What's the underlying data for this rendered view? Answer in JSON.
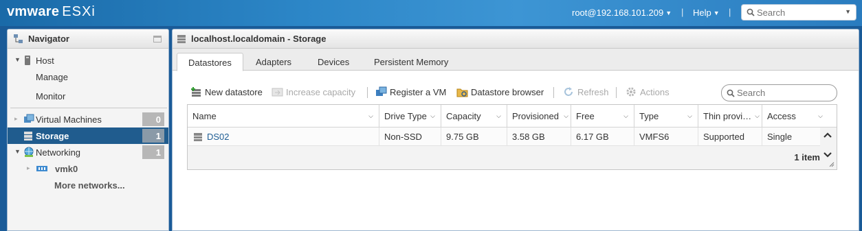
{
  "header": {
    "brand_vm": "vmware",
    "brand_product": "ESXi",
    "user": "root@192.168.101.209",
    "help": "Help",
    "search_placeholder": "Search"
  },
  "navigator": {
    "title": "Navigator",
    "host": "Host",
    "manage": "Manage",
    "monitor": "Monitor",
    "vms": {
      "label": "Virtual Machines",
      "count": "0"
    },
    "storage": {
      "label": "Storage",
      "count": "1"
    },
    "networking": {
      "label": "Networking",
      "count": "1"
    },
    "vmk0": "vmk0",
    "more_networks": "More networks..."
  },
  "main": {
    "title": "localhost.localdomain - Storage",
    "tabs": [
      "Datastores",
      "Adapters",
      "Devices",
      "Persistent Memory"
    ],
    "toolbar": {
      "new_datastore": "New datastore",
      "increase_capacity": "Increase capacity",
      "register_vm": "Register a VM",
      "datastore_browser": "Datastore browser",
      "refresh": "Refresh",
      "actions": "Actions"
    },
    "search_placeholder": "Search"
  },
  "grid": {
    "columns": [
      "Name",
      "Drive Type",
      "Capacity",
      "Provisioned",
      "Free",
      "Type",
      "Thin provi…",
      "Access"
    ],
    "rows": [
      {
        "name": "DS02",
        "drive_type": "Non-SSD",
        "capacity": "9.75 GB",
        "provisioned": "3.58 GB",
        "free": "6.17 GB",
        "type": "VMFS6",
        "thin": "Supported",
        "access": "Single"
      }
    ],
    "footer": "1 item"
  },
  "colors": {
    "header_blue": "#2c86c7",
    "selection": "#205c8e",
    "link": "#1e5d94"
  }
}
